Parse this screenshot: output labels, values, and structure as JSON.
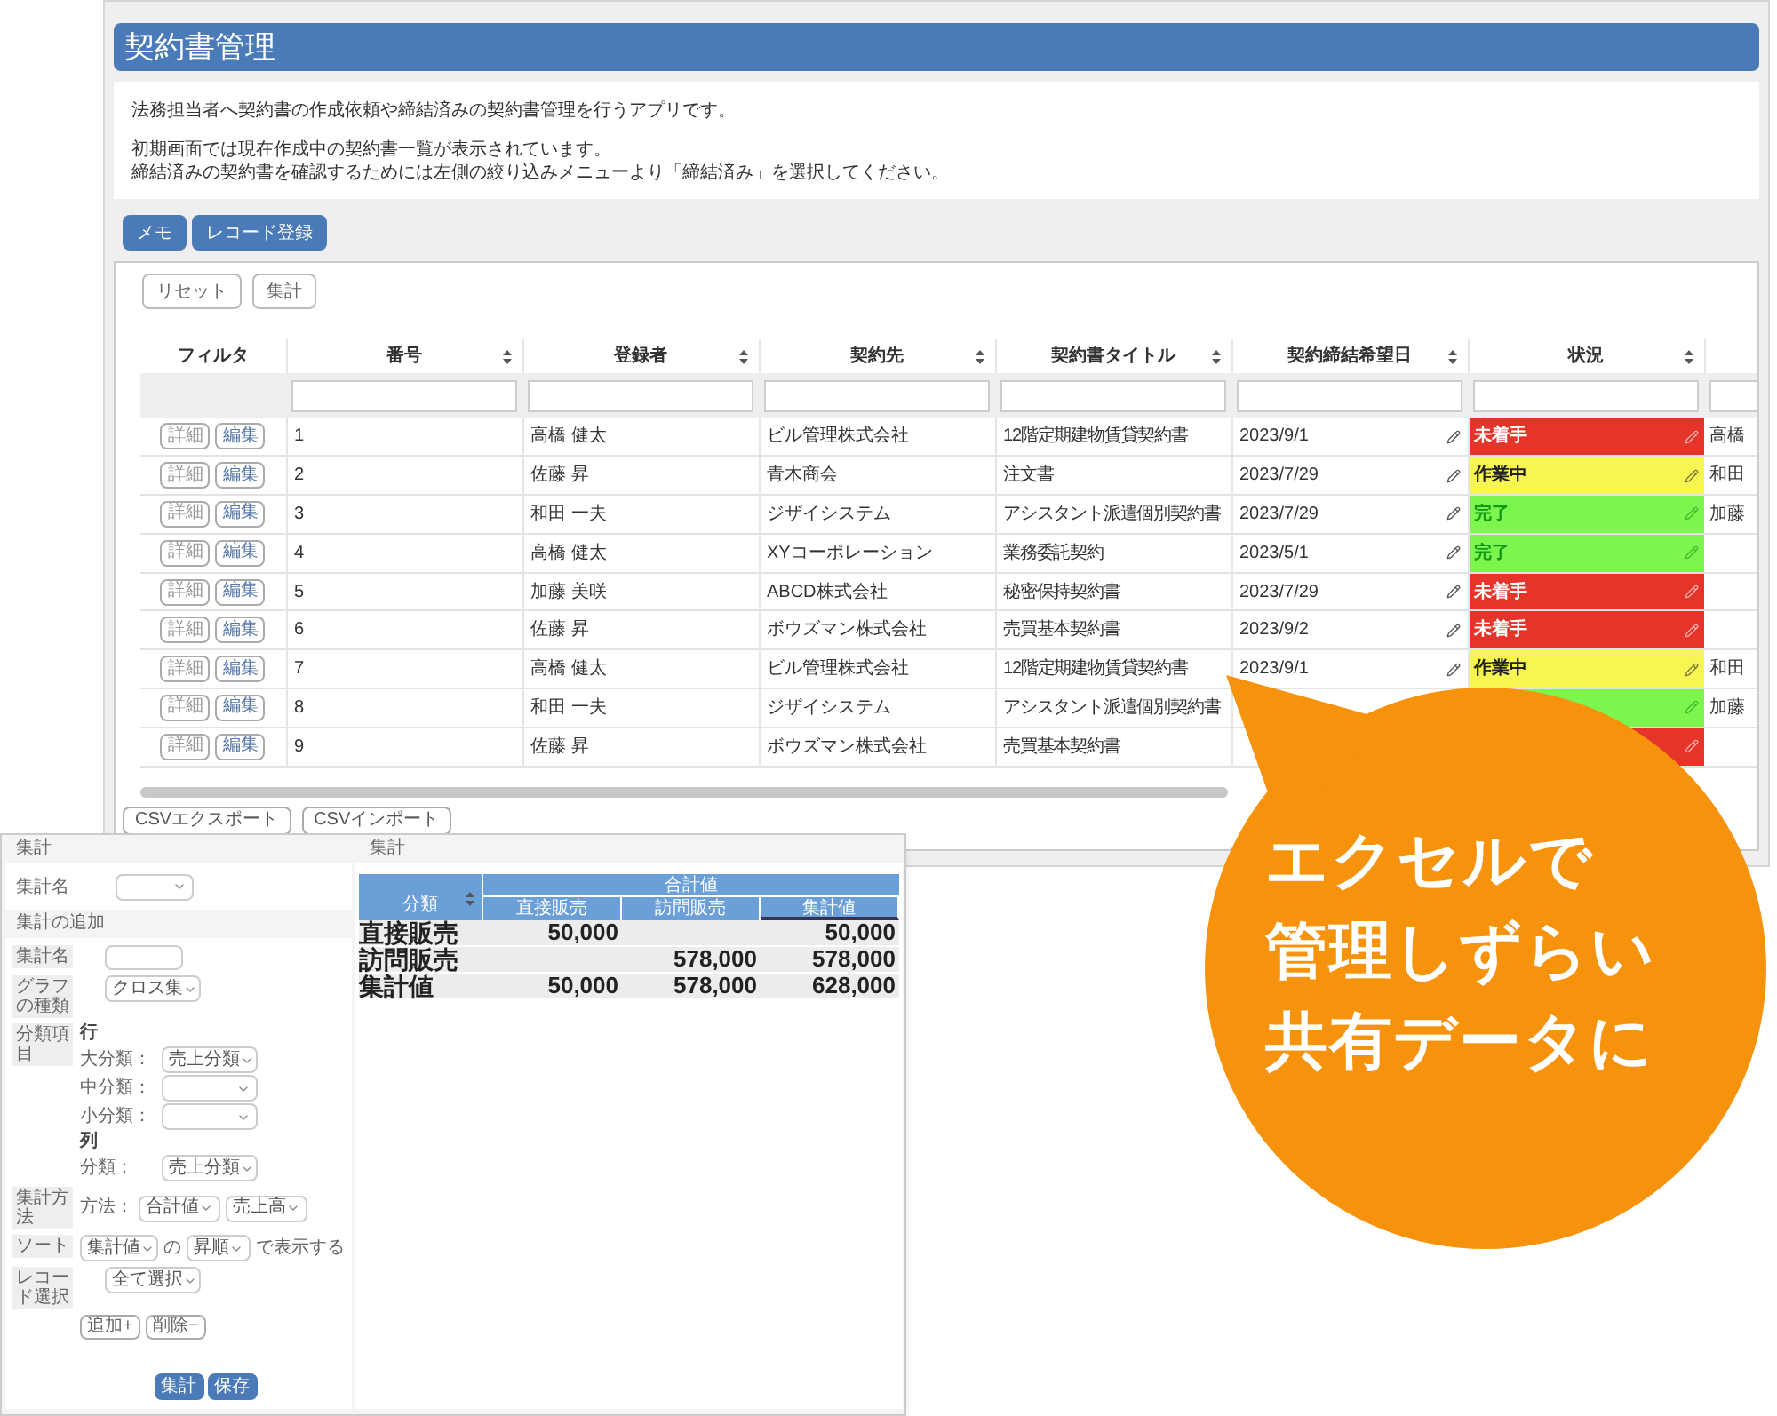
{
  "app": {
    "title": "契約書管理",
    "description": [
      "法務担当者へ契約書の作成依頼や締結済みの契約書管理を行うアプリです。",
      "初期画面では現在作成中の契約書一覧が表示されています。",
      "締結済みの契約書を確認するためには左側の絞り込みメニューより「締結済み」を選択してください。"
    ]
  },
  "buttons": [
    "メモ",
    "レコード登録"
  ],
  "toolbar": [
    "リセット",
    "集計"
  ],
  "table": {
    "columns": [
      {
        "label": "フィルタ",
        "sortable": false
      },
      {
        "label": "番号",
        "sortable": true
      },
      {
        "label": "登録者",
        "sortable": true
      },
      {
        "label": "契約先",
        "sortable": true
      },
      {
        "label": "契約書タイトル",
        "sortable": true
      },
      {
        "label": "契約締結希望日",
        "sortable": true
      },
      {
        "label": "状況",
        "sortable": true
      }
    ],
    "rows": [
      {
        "actions": [
          "詳細",
          "編集"
        ],
        "number": "1",
        "registrant": "高橋 健太",
        "counterparty": "ビル管理株式会社",
        "title": "12階定期建物賃貸契約書",
        "date": "2023/9/1",
        "status": {
          "kind": "todo",
          "label": "未着手"
        },
        "column_8": "高橋"
      },
      {
        "actions": [
          "詳細",
          "編集"
        ],
        "number": "2",
        "registrant": "佐藤 昇",
        "counterparty": "青木商会",
        "title": "注文書",
        "date": "2023/7/29",
        "status": {
          "kind": "doing",
          "label": "作業中"
        },
        "column_8": "和田"
      },
      {
        "actions": [
          "詳細",
          "編集"
        ],
        "number": "3",
        "registrant": "和田 一夫",
        "counterparty": "ジザイシステム",
        "title": "アシスタント派遣個別契約書",
        "date": "2023/7/29",
        "status": {
          "kind": "done",
          "label": "完了"
        },
        "column_8": "加藤"
      },
      {
        "actions": [
          "詳細",
          "編集"
        ],
        "number": "4",
        "registrant": "高橋 健太",
        "counterparty": "XYコーポレーション",
        "title": "業務委託契約",
        "date": "2023/5/1",
        "status": {
          "kind": "done",
          "label": "完了"
        }
      },
      {
        "actions": [
          "詳細",
          "編集"
        ],
        "number": "5",
        "registrant": "加藤 美咲",
        "counterparty": "ABCD株式会社",
        "title": "秘密保持契約書",
        "date": "2023/7/29",
        "status": {
          "kind": "todo",
          "label": "未着手"
        }
      },
      {
        "actions": [
          "詳細",
          "編集"
        ],
        "number": "6",
        "registrant": "佐藤 昇",
        "counterparty": "ボウズマン株式会社",
        "title": "売買基本契約書",
        "date": "2023/9/2",
        "status": {
          "kind": "todo",
          "label": "未着手"
        }
      },
      {
        "actions": [
          "詳細",
          "編集"
        ],
        "number": "7",
        "registrant": "高橋 健太",
        "counterparty": "ビル管理株式会社",
        "title": "12階定期建物賃貸契約書",
        "date": "2023/9/1",
        "status": {
          "kind": "doing",
          "label": "作業中"
        },
        "column_8": "和田"
      },
      {
        "actions": [
          "詳細",
          "編集"
        ],
        "number": "8",
        "registrant": "和田 一夫",
        "counterparty": "ジザイシステム",
        "title": "アシスタント派遣個別契約書",
        "status": {
          "kind": "done"
        },
        "column_8": "加藤"
      },
      {
        "actions": [
          "詳細",
          "編集"
        ],
        "number": "9",
        "registrant": "佐藤 昇",
        "counterparty": "ボウズマン株式会社",
        "title": "売買基本契約書",
        "status": {
          "kind": "todo"
        }
      }
    ]
  },
  "csv_buttons": [
    "CSVエクスポート",
    "CSVインポート"
  ],
  "summary_window": {
    "left_title": "集計",
    "name_label": "集計名",
    "add_title": "集計の追加",
    "form": [
      {
        "label": "集計名",
        "kind": "text"
      },
      {
        "label": "グラフの種類",
        "kind": "select",
        "value": "クロス集"
      },
      {
        "label": "分類項目",
        "kind": "groups",
        "groups": [
          {
            "heading": "行",
            "items": [
              {
                "label": "大分類：",
                "value": "売上分類"
              },
              {
                "label": "中分類："
              },
              {
                "label": "小分類："
              }
            ]
          },
          {
            "heading": "列",
            "items": [
              {
                "label": "分類：",
                "value": "売上分類"
              }
            ]
          }
        ]
      },
      {
        "label": "集計方法",
        "kind": "method",
        "prefix": "方法：",
        "selects": [
          "合計値",
          "売上高"
        ]
      },
      {
        "label": "ソート",
        "kind": "sort",
        "selects": [
          "集計値",
          "昇順"
        ],
        "words": [
          "の",
          "で表示する"
        ]
      },
      {
        "label": "レコード選択",
        "kind": "select",
        "value": "全て選択"
      }
    ],
    "row_buttons": [
      "追加+",
      "削除−"
    ],
    "actions": [
      "集計",
      "保存"
    ],
    "right_title": "集計",
    "pivot": {
      "row_header": "分類",
      "group": "合計値",
      "columns": [
        "直接販売",
        "訪問販売",
        "集計値"
      ],
      "rows": [
        {
          "label": "直接販売",
          "direct": "50,000",
          "total": "50,000"
        },
        {
          "label": "訪問販売",
          "visit": "578,000",
          "total": "578,000"
        },
        {
          "label": "集計値",
          "direct": "50,000",
          "visit": "578,000",
          "total": "628,000"
        }
      ]
    }
  },
  "bubble": [
    "エクセルで",
    "管理しずらい",
    "共有データに"
  ]
}
